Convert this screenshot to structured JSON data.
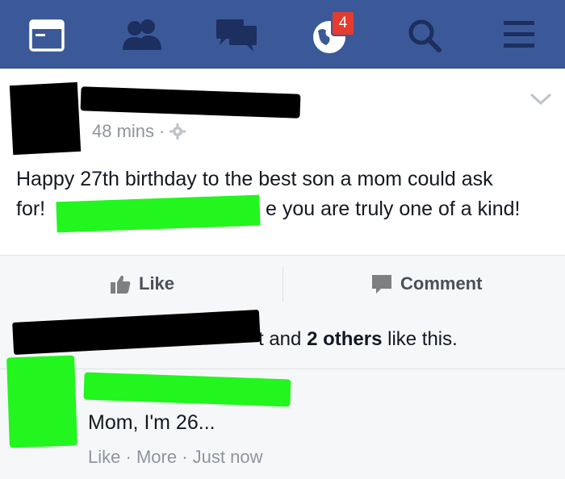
{
  "topbar": {
    "icons": [
      "news-feed-icon",
      "friends-icon",
      "messages-icon",
      "globe-icon",
      "search-icon",
      "menu-icon"
    ],
    "notification_count": "4",
    "bg_color": "#3b5998"
  },
  "post": {
    "author_redacted": true,
    "time": "48 mins",
    "separator": "·",
    "text_line1": "Happy 27th birthday to the best son a mom could ask",
    "text_line2_start": "for!",
    "text_line2_end": "e you are truly one of a kind!"
  },
  "actions": {
    "like_label": "Like",
    "comment_label": "Comment"
  },
  "likes": {
    "fragment": "t and",
    "count": "2 others",
    "suffix": "like this."
  },
  "comment": {
    "text": "Mom, I'm 26...",
    "like_label": "Like",
    "more_label": "More",
    "time": "Just now",
    "separator": "·"
  }
}
